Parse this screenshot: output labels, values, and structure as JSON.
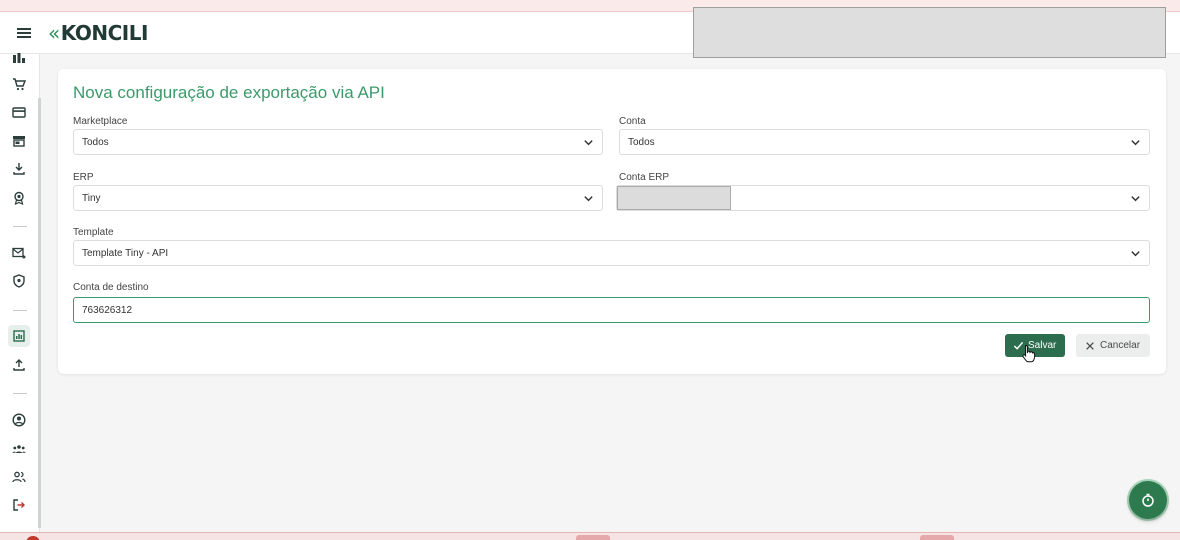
{
  "header": {
    "logo_text": "KONCILI",
    "logo_chevrons": "«"
  },
  "sidebar": {
    "icons": [
      "bar-chart-icon",
      "cart-icon",
      "credit-card-icon",
      "store-icon",
      "download-icon",
      "award-icon",
      "mail-forward-icon",
      "shield-icon",
      "report-icon",
      "upload-icon",
      "user-circle-icon",
      "group-icon",
      "users-icon",
      "logout-icon"
    ]
  },
  "form": {
    "title": "Nova configuração de exportação via API",
    "marketplace": {
      "label": "Marketplace",
      "value": "Todos"
    },
    "conta": {
      "label": "Conta",
      "value": "Todos"
    },
    "erp": {
      "label": "ERP",
      "value": "Tiny"
    },
    "conta_erp": {
      "label": "Conta ERP",
      "value": ""
    },
    "template": {
      "label": "Template",
      "value": "Template Tiny - API"
    },
    "conta_destino": {
      "label": "Conta de destino",
      "value": "763626312"
    },
    "save_label": "Salvar",
    "cancel_label": "Cancelar"
  },
  "colors": {
    "accent": "#3a9a6a",
    "save_button": "#2b6d4c",
    "fab": "#2c7a4e"
  }
}
